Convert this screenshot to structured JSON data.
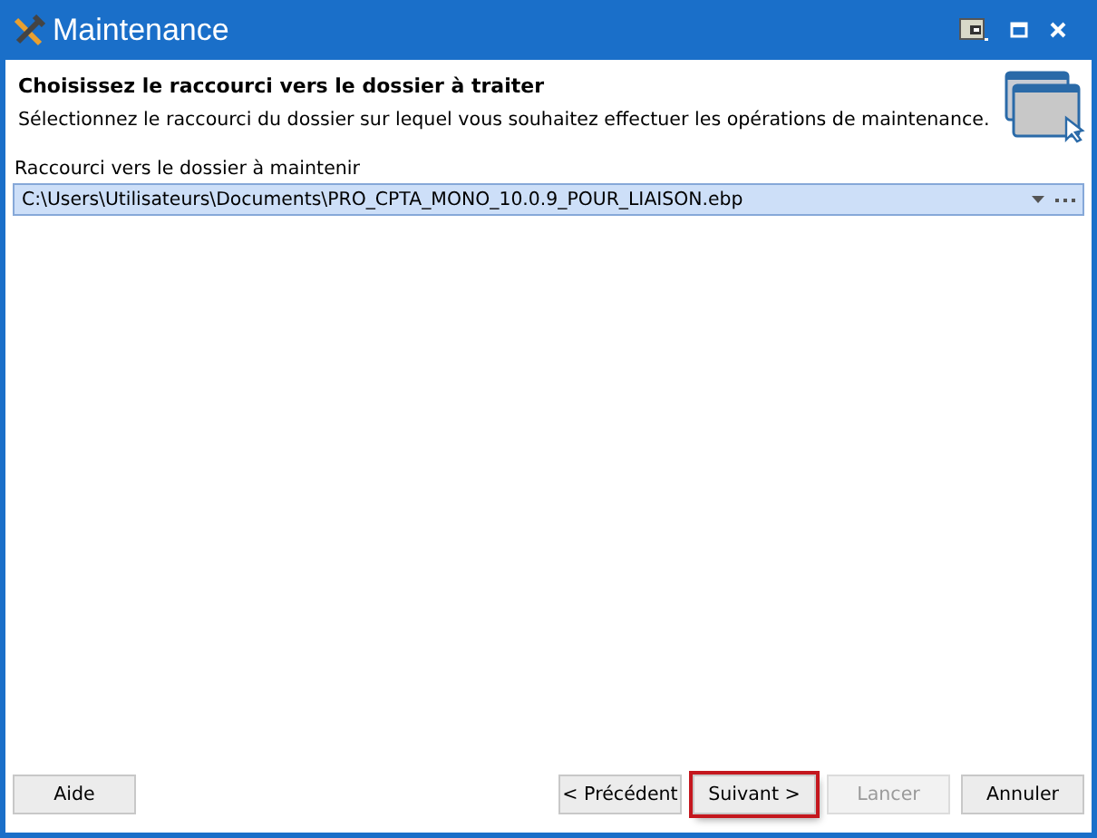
{
  "window": {
    "title": "Maintenance"
  },
  "header": {
    "title": "Choisissez le raccourci vers le dossier à traiter",
    "subtitle": "Sélectionnez le raccourci du dossier sur lequel vous souhaitez effectuer les opérations de maintenance."
  },
  "shortcut_field": {
    "label": "Raccourci vers le dossier à maintenir",
    "value": "C:\\Users\\Utilisateurs\\Documents\\PRO_CPTA_MONO_10.0.9_POUR_LIAISON.ebp"
  },
  "buttons": [
    {
      "label": "Aide",
      "disabled": false,
      "highlighted": false
    },
    {
      "label": "< Précédent",
      "disabled": false,
      "highlighted": false
    },
    {
      "label": "Suivant >",
      "disabled": false,
      "highlighted": true
    },
    {
      "label": "Lancer",
      "disabled": true,
      "highlighted": false
    },
    {
      "label": "Annuler",
      "disabled": false,
      "highlighted": false
    }
  ]
}
